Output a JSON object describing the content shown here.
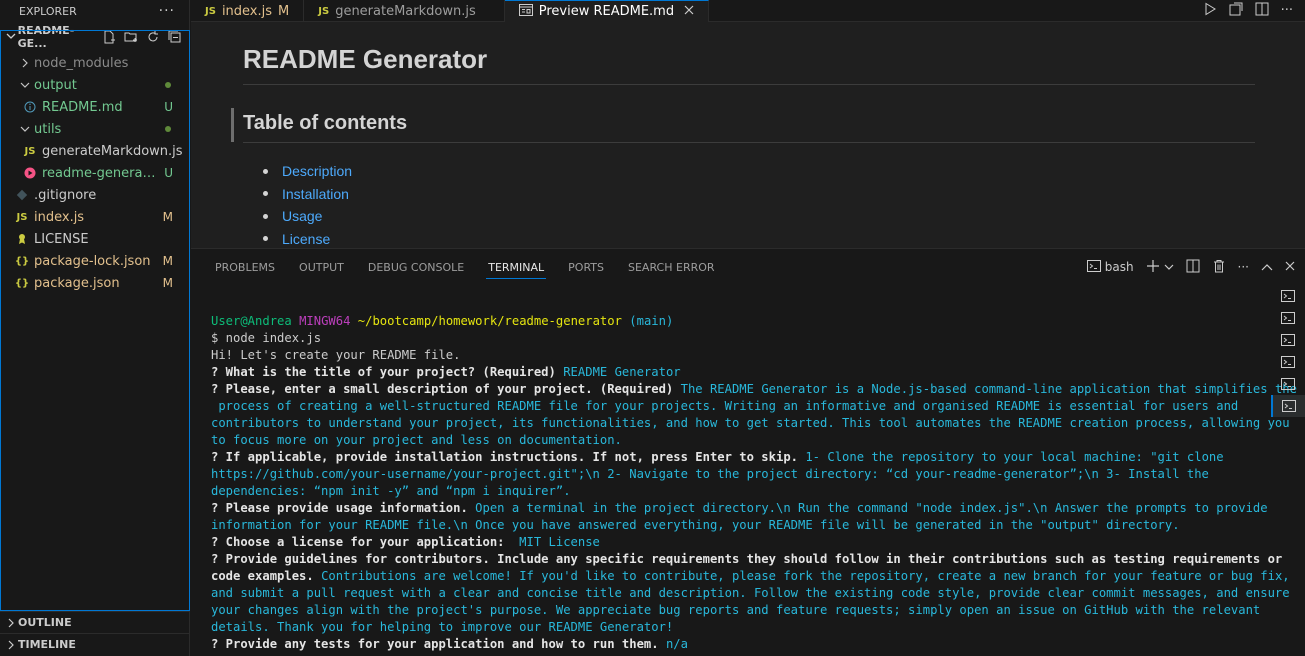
{
  "explorer": {
    "title": "EXPLORER",
    "more": "···"
  },
  "folder": {
    "name": "README-GE...",
    "collapse_icon": "chevron-down"
  },
  "tree": [
    {
      "label": "node_modules",
      "kind": "folder-collapsed",
      "color": "#8b8b8b"
    },
    {
      "label": "output",
      "kind": "folder-open",
      "color": "#73c991",
      "dot": true
    },
    {
      "label": "README.md",
      "kind": "info-file",
      "color": "#73c991",
      "badge": "U",
      "child": true
    },
    {
      "label": "utils",
      "kind": "folder-open",
      "color": "#73c991",
      "dot": true
    },
    {
      "label": "generateMarkdown.js",
      "kind": "js",
      "color": "#cccccc",
      "child": true
    },
    {
      "label": "readme-generator...",
      "kind": "video",
      "color": "#73c991",
      "badge": "U",
      "child": true
    },
    {
      "label": ".gitignore",
      "kind": "git",
      "color": "#cccccc"
    },
    {
      "label": "index.js",
      "kind": "js",
      "color": "#e2c08d",
      "badge": "M"
    },
    {
      "label": "LICENSE",
      "kind": "license",
      "color": "#cccccc"
    },
    {
      "label": "package-lock.json",
      "kind": "json",
      "color": "#e2c08d",
      "badge": "M"
    },
    {
      "label": "package.json",
      "kind": "json",
      "color": "#e2c08d",
      "badge": "M"
    }
  ],
  "outline": "OUTLINE",
  "timeline": "TIMELINE",
  "tabs": [
    {
      "label": "index.js",
      "icon": "JS",
      "mod": "M"
    },
    {
      "label": "generateMarkdown.js",
      "icon": "JS"
    },
    {
      "label": "Preview README.md",
      "icon": "preview",
      "active": true
    }
  ],
  "preview": {
    "h1": "README Generator",
    "h2": "Table of contents",
    "toc": [
      "Description",
      "Installation",
      "Usage",
      "License"
    ]
  },
  "panel": {
    "tabs": [
      "PROBLEMS",
      "OUTPUT",
      "DEBUG CONSOLE",
      "TERMINAL",
      "PORTS",
      "SEARCH ERROR"
    ],
    "active_tab": "TERMINAL",
    "shell": "bash"
  },
  "terminal": {
    "prompt_user": "User@Andrea",
    "prompt_env": "MINGW64",
    "prompt_path": "~/bootcamp/homework/readme-generator",
    "prompt_branch": "(main)",
    "cmd": "$ node index.js",
    "greet": "Hi! Let's create your README file.",
    "q1": "? What is the title of your project? (Required)",
    "a1": "README Generator",
    "q2": "? Please, enter a small description of your project. (Required)",
    "a2_1": "The README Generator is a Node.js-based command-line application that simplifies the",
    "a2_2": " process of creating a well-structured README file for your projects. Writing an informative and organised README is essential for users and",
    "a2_3": "contributors to understand your project, its functionalities, and how to get started. This tool automates the README creation process, allowing you",
    "a2_4": "to focus more on your project and less on documentation.",
    "q3": "? If applicable, provide installation instructions. If not, press Enter to skip.",
    "a3_1": "1- Clone the repository to your local machine: \"git clone",
    "a3_2": "https://github.com/your-username/your-project.git\";\\n 2- Navigate to the project directory: “cd your-readme-generator”;\\n 3- Install the",
    "a3_3": "dependencies: “npm init -y” and “npm i inquirer”.",
    "q4": "? Please provide usage information.",
    "a4_1": "Open a terminal in the project directory.\\n Run the command \"node index.js\".\\n Answer the prompts to provide",
    "a4_2": "information for your README file.\\n Once you have answered everything, your README file will be generated in the \"output\" directory.",
    "q5": "? Choose a license for your application:",
    "a5": " MIT License",
    "q6_1": "? Provide guidelines for contributors. Include any specific requirements they should follow in their contributions such as testing requirements or",
    "q6_2": "code examples.",
    "a6_1": "Contributions are welcome! If you'd like to contribute, please fork the repository, create a new branch for your feature or bug fix,",
    "a6_2": "and submit a pull request with a clear and concise title and description. Follow the existing code style, provide clear commit messages, and ensure",
    "a6_3": "your changes align with the project's purpose. We appreciate bug reports and feature requests; simply open an issue on GitHub with the relevant",
    "a6_4": "details. Thank you for helping to improve our README Generator!",
    "q7": "? Provide any tests for your application and how to run them.",
    "a7": "n/a"
  },
  "colors": {
    "accent": "#0078d4",
    "link": "#4daafc",
    "added": "#73c991",
    "modified": "#e2c08d"
  }
}
